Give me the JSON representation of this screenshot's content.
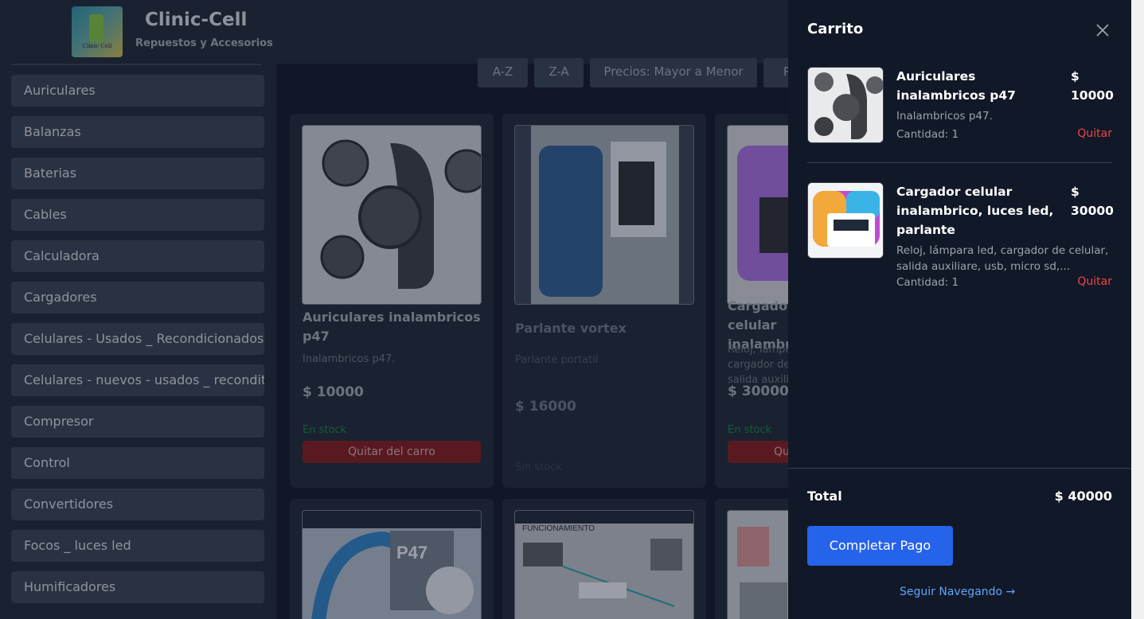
{
  "header": {
    "logo_text": "Clinic Cell",
    "title": "Clinic-Cell",
    "subtitle": "Repuestos y Accesorios"
  },
  "sidebar": {
    "categories": [
      "Auriculares",
      "Balanzas",
      "Baterias",
      "Cables",
      "Calculadora",
      "Cargadores",
      "Celulares - Usados _ Recondicionados",
      "Celulares - nuevos - usados _ reconditionados",
      "Compresor",
      "Control",
      "Convertidores",
      "Focos _ luces led",
      "Humificadores"
    ]
  },
  "sort": {
    "az": "A-Z",
    "za": "Z-A",
    "price_desc": "Precios: Mayor a Menor",
    "more": "P"
  },
  "products": [
    {
      "name": "Auriculares inalambricos p47",
      "description": "Inalambricos p47.",
      "price": "$ 10000",
      "stock": "En stock",
      "action": "Quitar del carro"
    },
    {
      "name": "Parlante vortex",
      "description": "Parlante portatil",
      "price": "$ 16000",
      "stock": "Sin stock"
    },
    {
      "name": "Cargador celular inalambrico",
      "description": "Reloj, lámpara led, cargador de celular, salida auxiliare",
      "price": "$ 30000",
      "stock": "En stock",
      "action": "Quitar del carro"
    }
  ],
  "row2_labels": {
    "funcionamiento": "FUNCIONAMIENTO",
    "p47": "P47"
  },
  "cart": {
    "title": "Carrito",
    "items": [
      {
        "name": "Auriculares inalambricos p47",
        "price_symbol": "$",
        "price": "10000",
        "description": "Inalambricos p47.",
        "quantity": "Cantidad: 1",
        "remove": "Quitar"
      },
      {
        "name": "Cargador celular inalambrico, luces led, parlante",
        "price_symbol": "$",
        "price": "30000",
        "description": "Reloj, lámpara led, cargador de celular, salida auxiliare, usb, micro sd,...",
        "quantity": "Cantidad: 1",
        "remove": "Quitar"
      }
    ],
    "total_label": "Total",
    "total_value": "$ 40000",
    "pay_button": "Completar Pago",
    "continue_link": "Seguir Navegando →"
  },
  "colors": {
    "accent": "#2563eb",
    "danger": "#ef4444",
    "link": "#60a5fa",
    "success": "#15803d"
  }
}
